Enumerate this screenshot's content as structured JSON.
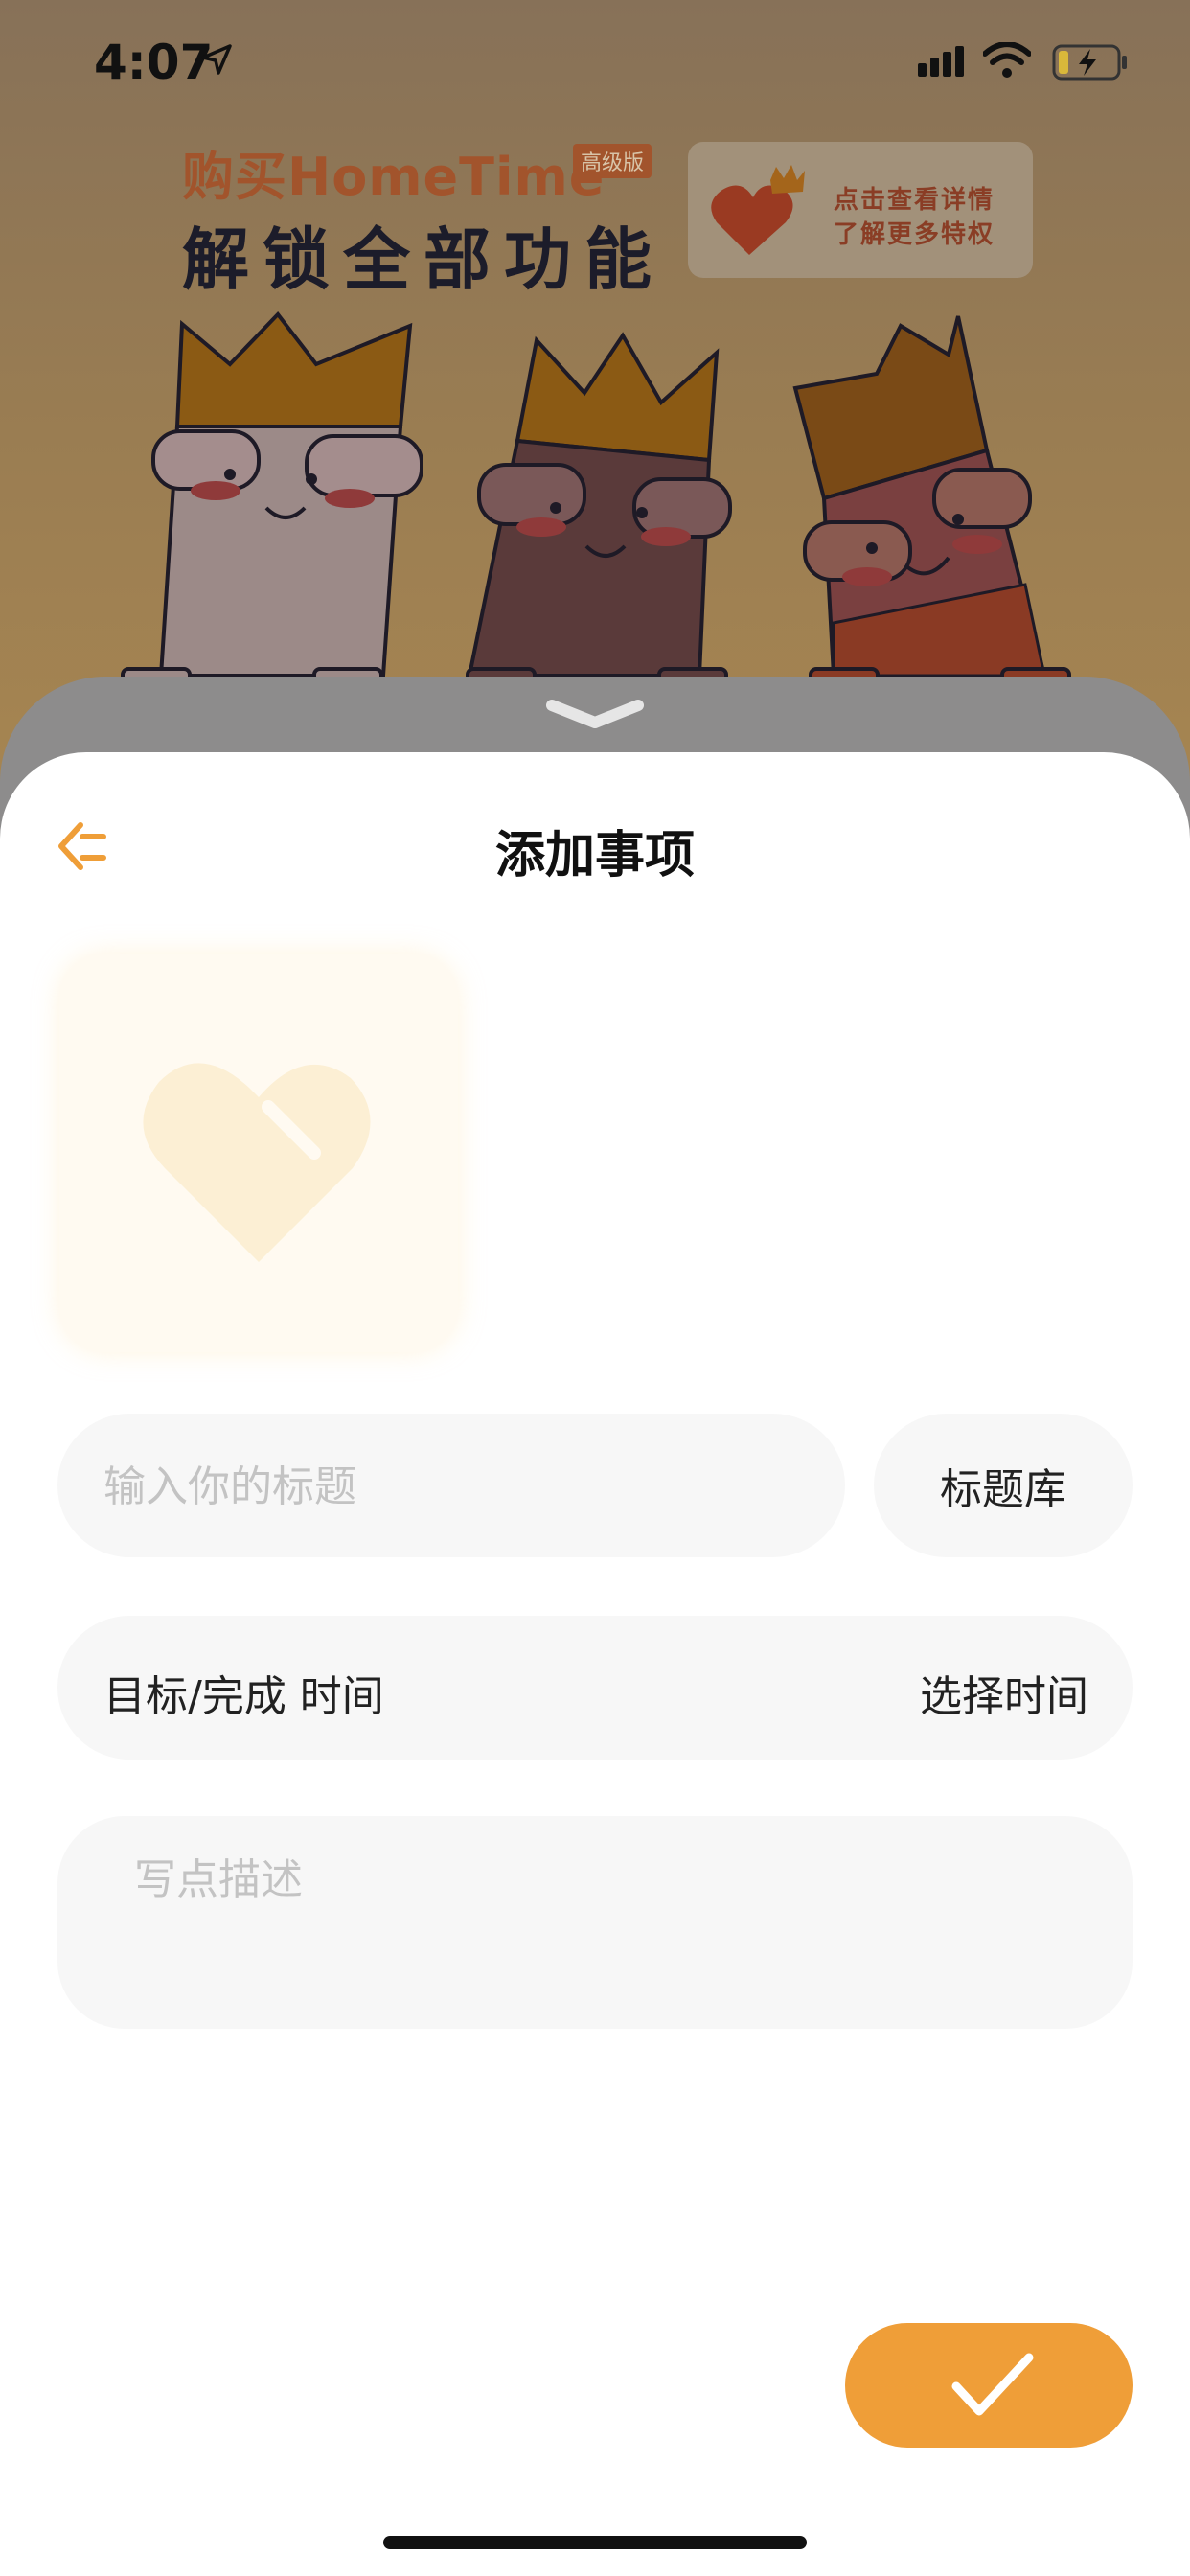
{
  "status_bar": {
    "time": "4:07"
  },
  "promo": {
    "line1": "购买HomeTime",
    "badge": "高级版",
    "line2": "解锁全部功能",
    "card_line1": "点击查看详情",
    "card_line2": "了解更多特权"
  },
  "header": {
    "title": "添加事项"
  },
  "form": {
    "title_placeholder": "输入你的标题",
    "title_library_label": "标题库",
    "time_label": "目标/完成 时间",
    "time_select_label": "选择时间",
    "description_placeholder": "写点描述"
  },
  "colors": {
    "accent": "#ef9e38",
    "field_bg": "#f7f7f7",
    "tile_bg": "#fffaf1"
  },
  "icons": {
    "back": "back-arrow-icon",
    "item": "heart-icon",
    "confirm": "checkmark-icon"
  }
}
